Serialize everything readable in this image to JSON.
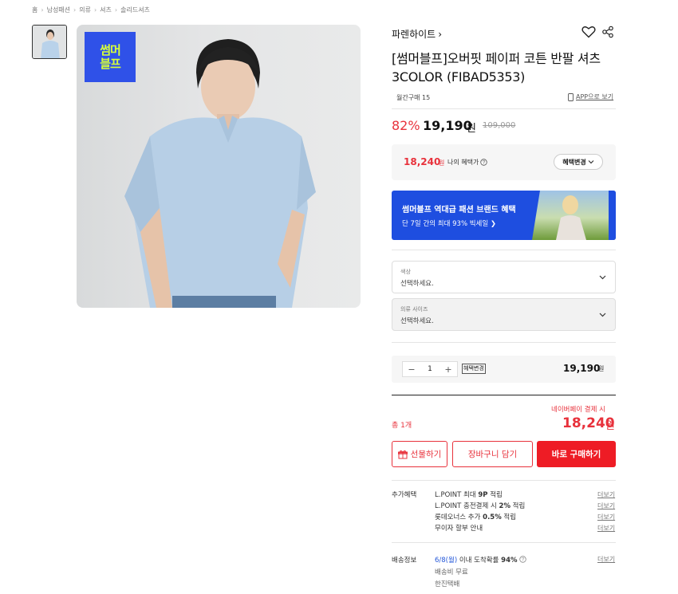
{
  "breadcrumb": [
    "홈",
    "남성패션",
    "의류",
    "셔츠",
    "솔리드셔츠"
  ],
  "promo_badge": {
    "line1": "썸머",
    "line2": "블프",
    "color": "#2f51e8",
    "text_color": "#d6ff3a"
  },
  "brand": {
    "name": "파렌하이트",
    "chevron": "›"
  },
  "product": {
    "title": "[썸머블프]오버핏 페이퍼 코튼 반팔 셔츠 3COLOR (FIBAD5353)",
    "monthly_sales": "월간구매 15",
    "app_link": "APP으로 보기"
  },
  "pricing": {
    "discount": "82%",
    "price": "19,190",
    "price_unit": "원",
    "original_price": "109,000"
  },
  "benefit": {
    "price": "18,240",
    "unit": "원",
    "label": "나의 혜택가",
    "change_button": "혜택변경"
  },
  "banner": {
    "title": "썸머블프 역대급 패션 브랜드 혜택",
    "subtitle": "단 7일 간의 최대 93% 빅세일 ❯"
  },
  "options": {
    "color": {
      "label": "색상",
      "placeholder": "선택하세요."
    },
    "size": {
      "label": "의류 사이즈",
      "placeholder": "선택하세요."
    }
  },
  "quantity": {
    "minus": "−",
    "value": "1",
    "plus": "+",
    "benefit_tag": "혜택변경",
    "price": "19,190",
    "price_unit": "원"
  },
  "total": {
    "naverpay_note": "네이버페이 결제 시",
    "count": "총 1개",
    "price": "18,240",
    "unit": "원"
  },
  "actions": {
    "gift": "선물하기",
    "cart": "장바구니 담기",
    "buy": "바로 구매하기"
  },
  "extra_benefits": {
    "title": "추가혜택",
    "lines": [
      {
        "pre": "L.POINT 최대 ",
        "bold": "9P",
        "post": " 적립"
      },
      {
        "pre": "L.POINT 충전결제 시 ",
        "bold": "2%",
        "post": " 적립"
      },
      {
        "pre": "롯데오너스 추가 ",
        "bold": "0.5%",
        "post": " 적립"
      },
      {
        "pre": "무이자 할부 안내",
        "bold": "",
        "post": ""
      }
    ],
    "more": "더보기"
  },
  "shipping": {
    "title": "배송정보",
    "date": "6/8(월)",
    "date_suffix": " 이내 도착확률 ",
    "probability": "94%",
    "fee": "배송비 무료",
    "carrier": "한진택배",
    "more": "더보기"
  },
  "colors": {
    "accent": "#e8323c",
    "banner": "#1e4ee0"
  }
}
